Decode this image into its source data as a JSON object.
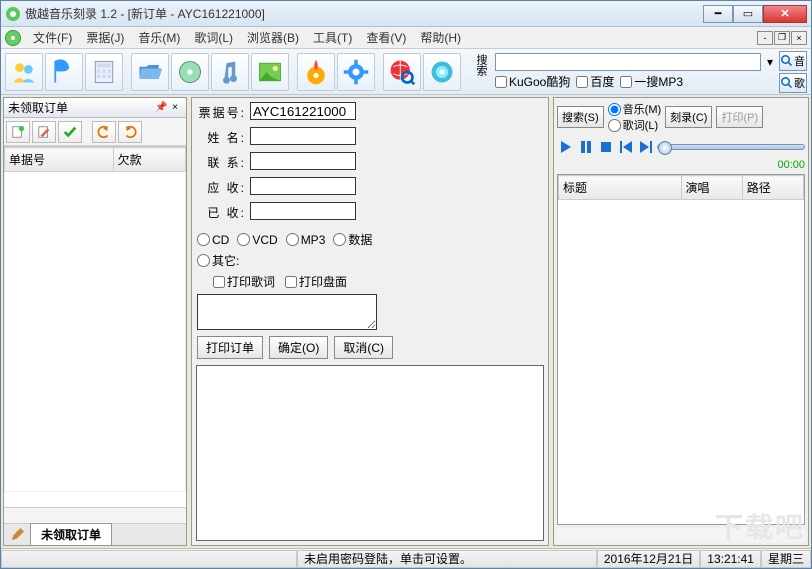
{
  "window": {
    "title": "傲越音乐刻录 1.2 - [新订单 - AYC161221000]"
  },
  "menu": {
    "file": "文件(F)",
    "ticket": "票据(J)",
    "music": "音乐(M)",
    "lyrics": "歌词(L)",
    "browser": "浏览器(B)",
    "tools": "工具(T)",
    "view": "查看(V)",
    "help": "帮助(H)"
  },
  "search": {
    "label": "搜索",
    "placeholder": "",
    "kugoo": "KuGoo酷狗",
    "baidu": "百度",
    "yisou": "一搜MP3",
    "btn_music": "音",
    "btn_lyrics": "歌"
  },
  "left": {
    "title": "未领取订单",
    "col1": "单据号",
    "col2": "欠款",
    "tab": "未领取订单"
  },
  "form": {
    "lbl_ticket": "票据号:",
    "ticket_val": "AYC161221000",
    "lbl_name": "姓 名:",
    "name_val": "",
    "lbl_contact": "联 系:",
    "contact_val": "",
    "lbl_recv": "应 收:",
    "recv_val": "",
    "lbl_paid": "已 收:",
    "paid_val": "",
    "opt_cd": "CD",
    "opt_vcd": "VCD",
    "opt_mp3": "MP3",
    "opt_data": "数据",
    "opt_other": "其它:",
    "chk_lyric": "打印歌词",
    "chk_cover": "打印盘面",
    "btn_print": "打印订单",
    "btn_ok": "确定(O)",
    "btn_cancel": "取消(C)"
  },
  "right": {
    "btn_search": "搜索(S)",
    "radio_music": "音乐(M)",
    "radio_lyric": "歌词(L)",
    "btn_burn": "刻录(C)",
    "btn_print": "打印(P)",
    "time": "00:00",
    "col_title": "标题",
    "col_singer": "演唱",
    "col_path": "路径"
  },
  "status": {
    "msg": "未启用密码登陆，单击可设置。",
    "date": "2016年12月21日",
    "time": "13:21:41",
    "weekday": "星期三"
  },
  "watermark": "下载吧"
}
